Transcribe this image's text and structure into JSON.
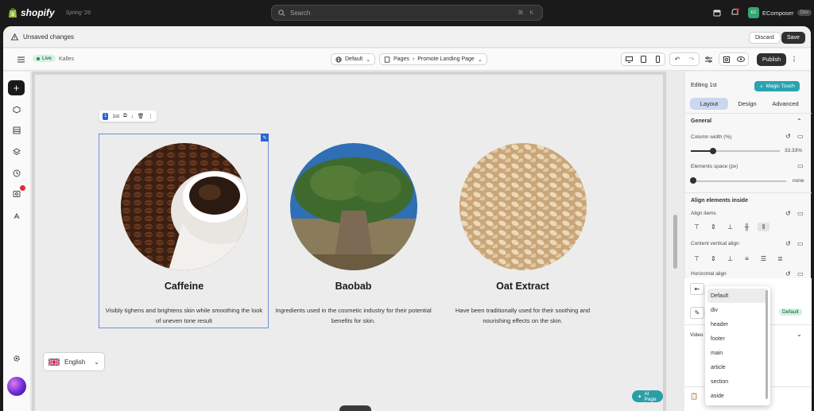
{
  "topbar": {
    "logo": "shopify",
    "edition": "Spring '26",
    "search_placeholder": "Search",
    "search_shortcut": "⌘ K",
    "store_initials": "EC",
    "store_name": "EComposer",
    "store_badge": "Dev"
  },
  "unsaved": {
    "text": "Unsaved changes",
    "discard": "Discard",
    "save": "Save"
  },
  "toolbar": {
    "live": "Live",
    "theme": "Kalles",
    "template": "Default",
    "pages": "Pages",
    "page_name": "Promote Landing Page",
    "publish": "Publish"
  },
  "canvas": {
    "mini_index": "1",
    "mini_label": "1st",
    "columns": [
      {
        "title": "Caffeine",
        "desc": "Visibly tighens and brightens skin while smoothing the look of uneven tone result"
      },
      {
        "title": "Baobab",
        "desc": "Ingredients used in the cosmetic industry for their potential benefits for skin."
      },
      {
        "title": "Oat Extract",
        "desc": "Have been traditionally used for their soothing and nourishing effects on the skin."
      }
    ],
    "language": "English",
    "ai_page": "AI Page"
  },
  "panel": {
    "editing": "Editing 1st",
    "magic": "Magic Touch",
    "tabs": [
      "Layout",
      "Design",
      "Advanced"
    ],
    "general": "General",
    "column_width_label": "Column width (%)",
    "column_width_value": "33.33%",
    "column_width_fraction": 0.25,
    "elements_space_label": "Elements space (px)",
    "elements_space_value": "none",
    "align_inside": "Align elements inside",
    "align_items": "Align items",
    "content_vertical_align": "Content vertical align",
    "horizontal_align": "Horizontal align",
    "default_badge": "Default",
    "video_label": "Video"
  },
  "dropdown": {
    "options": [
      "Default",
      "div",
      "header",
      "footer",
      "main",
      "article",
      "section",
      "aside"
    ],
    "selected": "Default"
  }
}
